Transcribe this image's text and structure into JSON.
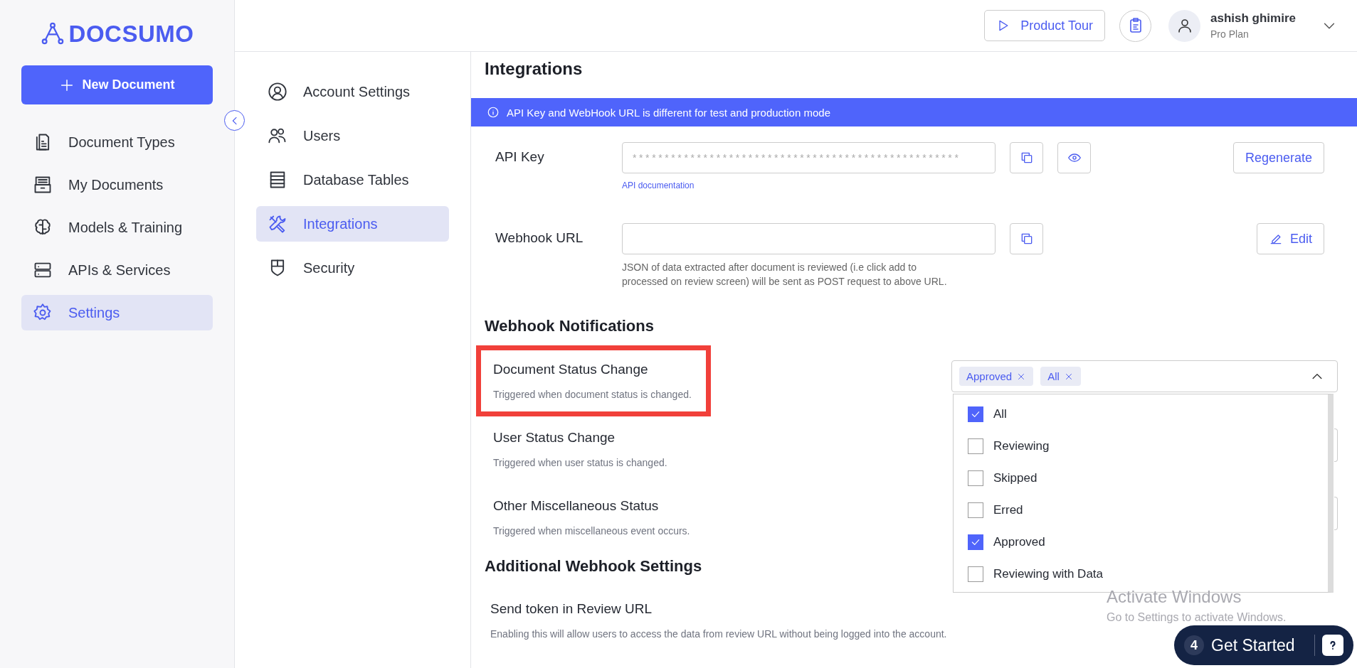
{
  "logo": {
    "text": "DOCSUMO"
  },
  "new_document_button": {
    "label": "New Document"
  },
  "sidebar": {
    "items": [
      {
        "label": "Document Types",
        "selected": false
      },
      {
        "label": "My Documents",
        "selected": false
      },
      {
        "label": "Models & Training",
        "selected": false
      },
      {
        "label": "APIs & Services",
        "selected": false
      },
      {
        "label": "Settings",
        "selected": true
      }
    ]
  },
  "top_bar": {
    "product_tour_button": {
      "label": "Product Tour"
    },
    "user": {
      "name": "ashish ghimire",
      "plan": "Pro Plan"
    }
  },
  "settings_menu": {
    "items": [
      {
        "label": "Account Settings",
        "selected": false
      },
      {
        "label": "Users",
        "selected": false
      },
      {
        "label": "Database Tables",
        "selected": false
      },
      {
        "label": "Integrations",
        "selected": true
      },
      {
        "label": "Security",
        "selected": false
      }
    ]
  },
  "page": {
    "title": "Integrations",
    "banner": "API Key and WebHook URL is different for test and production mode",
    "api_key": {
      "label": "API Key",
      "value": "***************************************************",
      "link": "API documentation",
      "button": "Regenerate"
    },
    "webhook_url": {
      "label": "Webhook URL",
      "help": "JSON of data extracted after document is reviewed (i.e click add to processed on review screen) will be sent as POST request to above URL.",
      "button": "Edit"
    },
    "webhook_notifications": {
      "title": "Webhook Notifications",
      "items": [
        {
          "title": "Document Status Change",
          "description": "Triggered when document status is changed.",
          "highlighted": true,
          "tags": [
            "Approved",
            "All"
          ],
          "expanded": true,
          "options": [
            {
              "label": "All",
              "checked": true
            },
            {
              "label": "Reviewing",
              "checked": false
            },
            {
              "label": "Skipped",
              "checked": false
            },
            {
              "label": "Erred",
              "checked": false
            },
            {
              "label": "Approved",
              "checked": true
            },
            {
              "label": "Reviewing with Data",
              "checked": false
            }
          ]
        },
        {
          "title": "User Status Change",
          "description": "Triggered when user status is changed.",
          "highlighted": false
        },
        {
          "title": "Other Miscellaneous Status",
          "description": "Triggered when miscellaneous event occurs.",
          "highlighted": false
        }
      ]
    },
    "additional_webhook_settings": {
      "title": "Additional Webhook Settings",
      "items": [
        {
          "title": "Send token in Review URL",
          "description": "Enabling this will allow users to access the data from review URL without being logged into the account."
        }
      ]
    }
  },
  "get_started": {
    "count": "4",
    "label": "Get Started"
  },
  "os_notice": {
    "title": "Activate Windows",
    "text": "Go to Settings to activate Windows."
  }
}
